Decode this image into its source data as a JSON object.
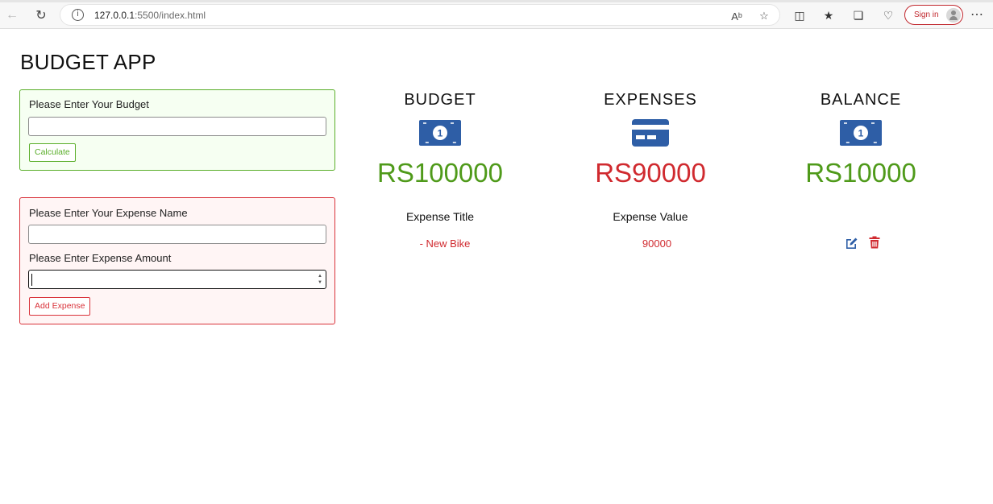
{
  "browser": {
    "url_host": "127.0.0.1",
    "url_rest": ":5500/index.html",
    "sign_in_label": "Sign in"
  },
  "app": {
    "title": "BUDGET APP"
  },
  "budget_form": {
    "label": "Please Enter Your Budget",
    "input_value": "",
    "button_label": "Calculate"
  },
  "expense_form": {
    "name_label": "Please Enter Your Expense Name",
    "name_value": "",
    "amount_label": "Please Enter Expense Amount",
    "amount_value": "",
    "button_label": "Add Expense"
  },
  "summary": {
    "budget": {
      "title": "BUDGET",
      "amount": "RS100000",
      "icon": "money-bill-icon",
      "color": "#4f9a1a"
    },
    "expenses": {
      "title": "EXPENSES",
      "amount": "RS90000",
      "icon": "credit-card-icon",
      "color": "#d02a2f"
    },
    "balance": {
      "title": "BALANCE",
      "amount": "RS10000",
      "icon": "money-bill-icon",
      "color": "#4f9a1a"
    }
  },
  "expense_list": {
    "headers": {
      "title": "Expense Title",
      "value": "Expense Value"
    },
    "items": [
      {
        "title": "- New Bike",
        "value": "90000"
      }
    ]
  },
  "colors": {
    "icon_blue": "#2e5ea6",
    "green": "#4f9a1a",
    "red": "#d02a2f"
  }
}
